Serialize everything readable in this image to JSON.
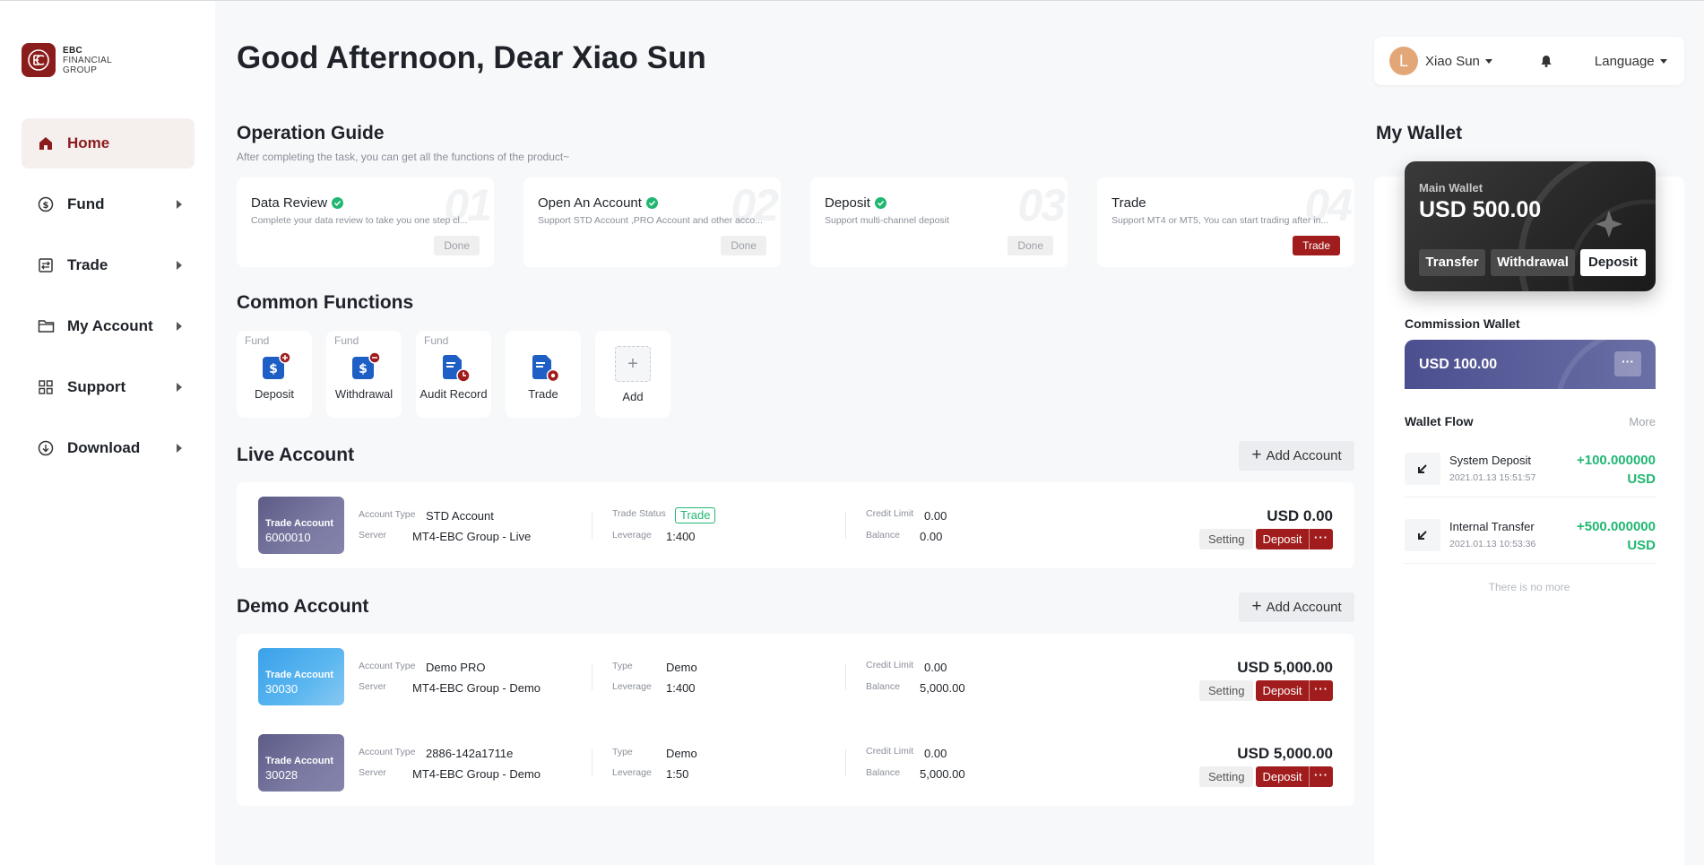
{
  "brand": {
    "line1": "EBC",
    "line2": "FINANCIAL",
    "line3": "GROUP"
  },
  "sidebar": {
    "items": [
      {
        "label": "Home",
        "icon": "home-icon",
        "active": true
      },
      {
        "label": "Fund",
        "icon": "dollar-circle-icon"
      },
      {
        "label": "Trade",
        "icon": "trade-icon"
      },
      {
        "label": "My Account",
        "icon": "folder-icon"
      },
      {
        "label": "Support",
        "icon": "grid-icon"
      },
      {
        "label": "Download",
        "icon": "download-icon"
      }
    ]
  },
  "header": {
    "greeting": "Good Afternoon, Dear Xiao Sun",
    "avatar_letter": "L",
    "user_name": "Xiao Sun",
    "language_label": "Language"
  },
  "guide": {
    "title": "Operation Guide",
    "subtitle": "After completing the task, you can get all the functions of the product~",
    "steps": [
      {
        "num": "01",
        "title": "Data Review",
        "desc": "Complete your data review to take you one step cl...",
        "button": "Done",
        "checked": true
      },
      {
        "num": "02",
        "title": "Open An Account",
        "desc": "Support STD Account ,PRO Account and other acco...",
        "button": "Done",
        "checked": true
      },
      {
        "num": "03",
        "title": "Deposit",
        "desc": "Support multi-channel deposit",
        "button": "Done",
        "checked": true
      },
      {
        "num": "04",
        "title": "Trade",
        "desc": "Support MT4 or MT5, You can start trading after in...",
        "button": "Trade",
        "checked": false
      }
    ]
  },
  "functions": {
    "title": "Common Functions",
    "items": [
      {
        "tag": "Fund",
        "label": "Deposit"
      },
      {
        "tag": "Fund",
        "label": "Withdrawal"
      },
      {
        "tag": "Fund",
        "label": "Audit Record"
      },
      {
        "tag": "",
        "label": "Trade"
      },
      {
        "tag": "",
        "label": "Add"
      }
    ]
  },
  "live": {
    "title": "Live Account",
    "add_label": "Add Account",
    "accounts": [
      {
        "badge_title": "Trade Account",
        "badge_number": "6000010",
        "type_label": "Account Type",
        "type": "STD Account",
        "server_label": "Server",
        "server": "MT4-EBC Group - Live",
        "status_label": "Trade Status",
        "status": "Trade",
        "leverage_label": "Leverage",
        "leverage": "1:400",
        "credit_label": "Credit Limit",
        "credit": "0.00",
        "balance_label": "Balance",
        "balance": "0.00",
        "amount": "USD 0.00",
        "setting": "Setting",
        "deposit": "Deposit",
        "more": "···"
      }
    ]
  },
  "demo": {
    "title": "Demo Account",
    "add_label": "Add Account",
    "accounts": [
      {
        "badge_title": "Trade Account",
        "badge_number": "30030",
        "type_label": "Account Type",
        "type": "Demo PRO",
        "server_label": "Server",
        "server": "MT4-EBC Group - Demo",
        "kind_label": "Type",
        "kind": "Demo",
        "leverage_label": "Leverage",
        "leverage": "1:400",
        "credit_label": "Credit Limit",
        "credit": "0.00",
        "balance_label": "Balance",
        "balance": "5,000.00",
        "amount": "USD 5,000.00",
        "setting": "Setting",
        "deposit": "Deposit",
        "more": "···"
      },
      {
        "badge_title": "Trade Account",
        "badge_number": "30028",
        "type_label": "Account Type",
        "type": "2886-142a1711e",
        "server_label": "Server",
        "server": "MT4-EBC Group - Demo",
        "kind_label": "Type",
        "kind": "Demo",
        "leverage_label": "Leverage",
        "leverage": "1:50",
        "credit_label": "Credit Limit",
        "credit": "0.00",
        "balance_label": "Balance",
        "balance": "5,000.00",
        "amount": "USD 5,000.00",
        "setting": "Setting",
        "deposit": "Deposit",
        "more": "···"
      }
    ]
  },
  "wallet": {
    "title": "My Wallet",
    "main_label": "Main Wallet",
    "main_amount": "USD 500.00",
    "transfer": "Transfer",
    "withdrawal": "Withdrawal",
    "deposit": "Deposit",
    "commission_title": "Commission Wallet",
    "commission_amount": "USD 100.00",
    "commission_more": "···",
    "flow_title": "Wallet Flow",
    "flow_more": "More",
    "flows": [
      {
        "name": "System Deposit",
        "time": "2021.01.13 15:51:57",
        "amount": "+100.000000",
        "currency": "USD"
      },
      {
        "name": "Internal Transfer",
        "time": "2021.01.13 10:53:36",
        "amount": "+500.000000",
        "currency": "USD"
      }
    ],
    "no_more": "There is no more"
  },
  "colors": {
    "brand": "#8b1c1c",
    "accent_red": "#a11d1d",
    "success": "#21b772"
  }
}
